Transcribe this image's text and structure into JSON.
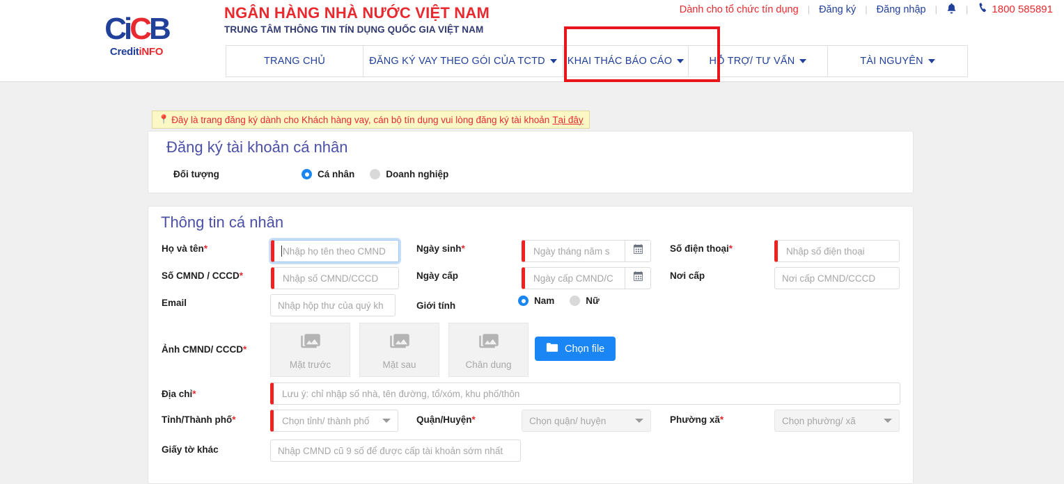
{
  "header": {
    "logo": {
      "mark_a": "Ci",
      "mark_b": "C",
      "mark_c": "B",
      "sub_a": "Credit",
      "sub_b": "i",
      "sub_c": "NFO"
    },
    "brand_title": "NGÂN HÀNG NHÀ NƯỚC VIỆT NAM",
    "brand_subtitle": "TRUNG TÂM THÔNG TIN TÍN DỤNG QUỐC GIA VIỆT NAM",
    "util_nav": {
      "for_credit_orgs": "Dành cho tổ chức tín dụng",
      "register": "Đăng ký",
      "login": "Đăng nhập",
      "bell_icon": "bell-icon",
      "phone_icon": "phone-icon",
      "phone": "1800 585891",
      "separator": "|"
    },
    "main_nav": [
      {
        "label": "TRANG CHỦ",
        "has_caret": false,
        "name": "nav-trang-chu"
      },
      {
        "label": "ĐĂNG KÝ VAY THEO GÓI CỦA TCTD",
        "has_caret": true,
        "name": "nav-dang-ky-vay"
      },
      {
        "label": "KHAI THÁC BÁO CÁO",
        "has_caret": true,
        "name": "nav-khai-thac-bao-cao"
      },
      {
        "label": "HỖ TRỢ/ TƯ VẤN",
        "has_caret": true,
        "name": "nav-ho-tro-tu-van"
      },
      {
        "label": "TÀI NGUYÊN",
        "has_caret": true,
        "name": "nav-tai-nguyen"
      }
    ],
    "annotation": {
      "highlight_color": "#e8151b",
      "target": "KHAI THÁC BÁO CÁO"
    }
  },
  "notice": {
    "pin_icon": "pin-icon",
    "text": "Đây là trang đăng ký dành cho Khách hàng vay, cán bộ tín dụng vui lòng đăng ký tài khoản",
    "link": "Tại đây",
    "bg_color": "#fbf8c6",
    "text_color": "#e8292f"
  },
  "account_card": {
    "title": "Đăng ký tài khoản cá nhân",
    "subject_label": "Đối tượng",
    "options": [
      {
        "label": "Cá nhân",
        "selected": true
      },
      {
        "label": "Doanh nghiệp",
        "selected": false
      }
    ]
  },
  "personal_info": {
    "title": "Thông tin cá nhân",
    "fields": {
      "full_name": {
        "label": "Họ và tên",
        "required": true,
        "placeholder": "Nhập họ tên theo CMND",
        "value": "",
        "focused": true
      },
      "id_number": {
        "label": "Số CMND / CCCD",
        "required": true,
        "placeholder": "Nhập số CMND/CCCD",
        "value": ""
      },
      "email": {
        "label": "Email",
        "required": false,
        "placeholder": "Nhập hộp thư của quý kh",
        "value": ""
      },
      "birth_date": {
        "label": "Ngày sinh",
        "required": true,
        "placeholder": "Ngày tháng năm s",
        "value": "",
        "icon": "calendar-icon"
      },
      "issue_date": {
        "label": "Ngày cấp",
        "required": false,
        "placeholder": "Ngày cấp CMND/C",
        "value": "",
        "icon": "calendar-icon"
      },
      "phone": {
        "label": "Số điện thoại",
        "required": true,
        "placeholder": "Nhập số điện thoại",
        "value": ""
      },
      "issue_place": {
        "label": "Nơi cấp",
        "required": false,
        "placeholder": "Nơi cấp CMND/CCCD",
        "value": ""
      },
      "gender": {
        "label": "Giới tính",
        "options": [
          {
            "label": "Nam",
            "selected": true
          },
          {
            "label": "Nữ",
            "selected": false
          }
        ]
      },
      "id_photos": {
        "label": "Ảnh CMND/ CCCD",
        "required": true,
        "boxes": [
          {
            "caption": "Mặt trước",
            "icon": "image-placeholder-icon"
          },
          {
            "caption": "Mặt sau",
            "icon": "image-placeholder-icon"
          },
          {
            "caption": "Chân dung",
            "icon": "image-placeholder-icon"
          }
        ],
        "button": {
          "label": "Chọn file",
          "icon": "folder-icon",
          "color": "#1a85f5"
        }
      },
      "address": {
        "label": "Địa chỉ",
        "required": true,
        "placeholder": "Lưu ý: chỉ nhập số nhà, tên đường, tổ/xóm, khu phố/thôn",
        "value": ""
      },
      "province": {
        "label": "Tỉnh/Thành phố",
        "required": true,
        "placeholder": "Chọn tỉnh/ thành phố",
        "value": "",
        "type": "select"
      },
      "district": {
        "label": "Quận/Huyện",
        "required": true,
        "placeholder": "Chọn quận/ huyện",
        "value": "",
        "type": "select",
        "disabled": true
      },
      "ward": {
        "label": "Phường xã",
        "required": true,
        "placeholder": "Chọn phường/ xã",
        "value": "",
        "type": "select",
        "disabled": true
      },
      "other_docs": {
        "label": "Giấy tờ khác",
        "required": false,
        "placeholder": "Nhập CMND cũ 9 số để được cấp tài khoản sớm nhất",
        "value": ""
      }
    }
  }
}
